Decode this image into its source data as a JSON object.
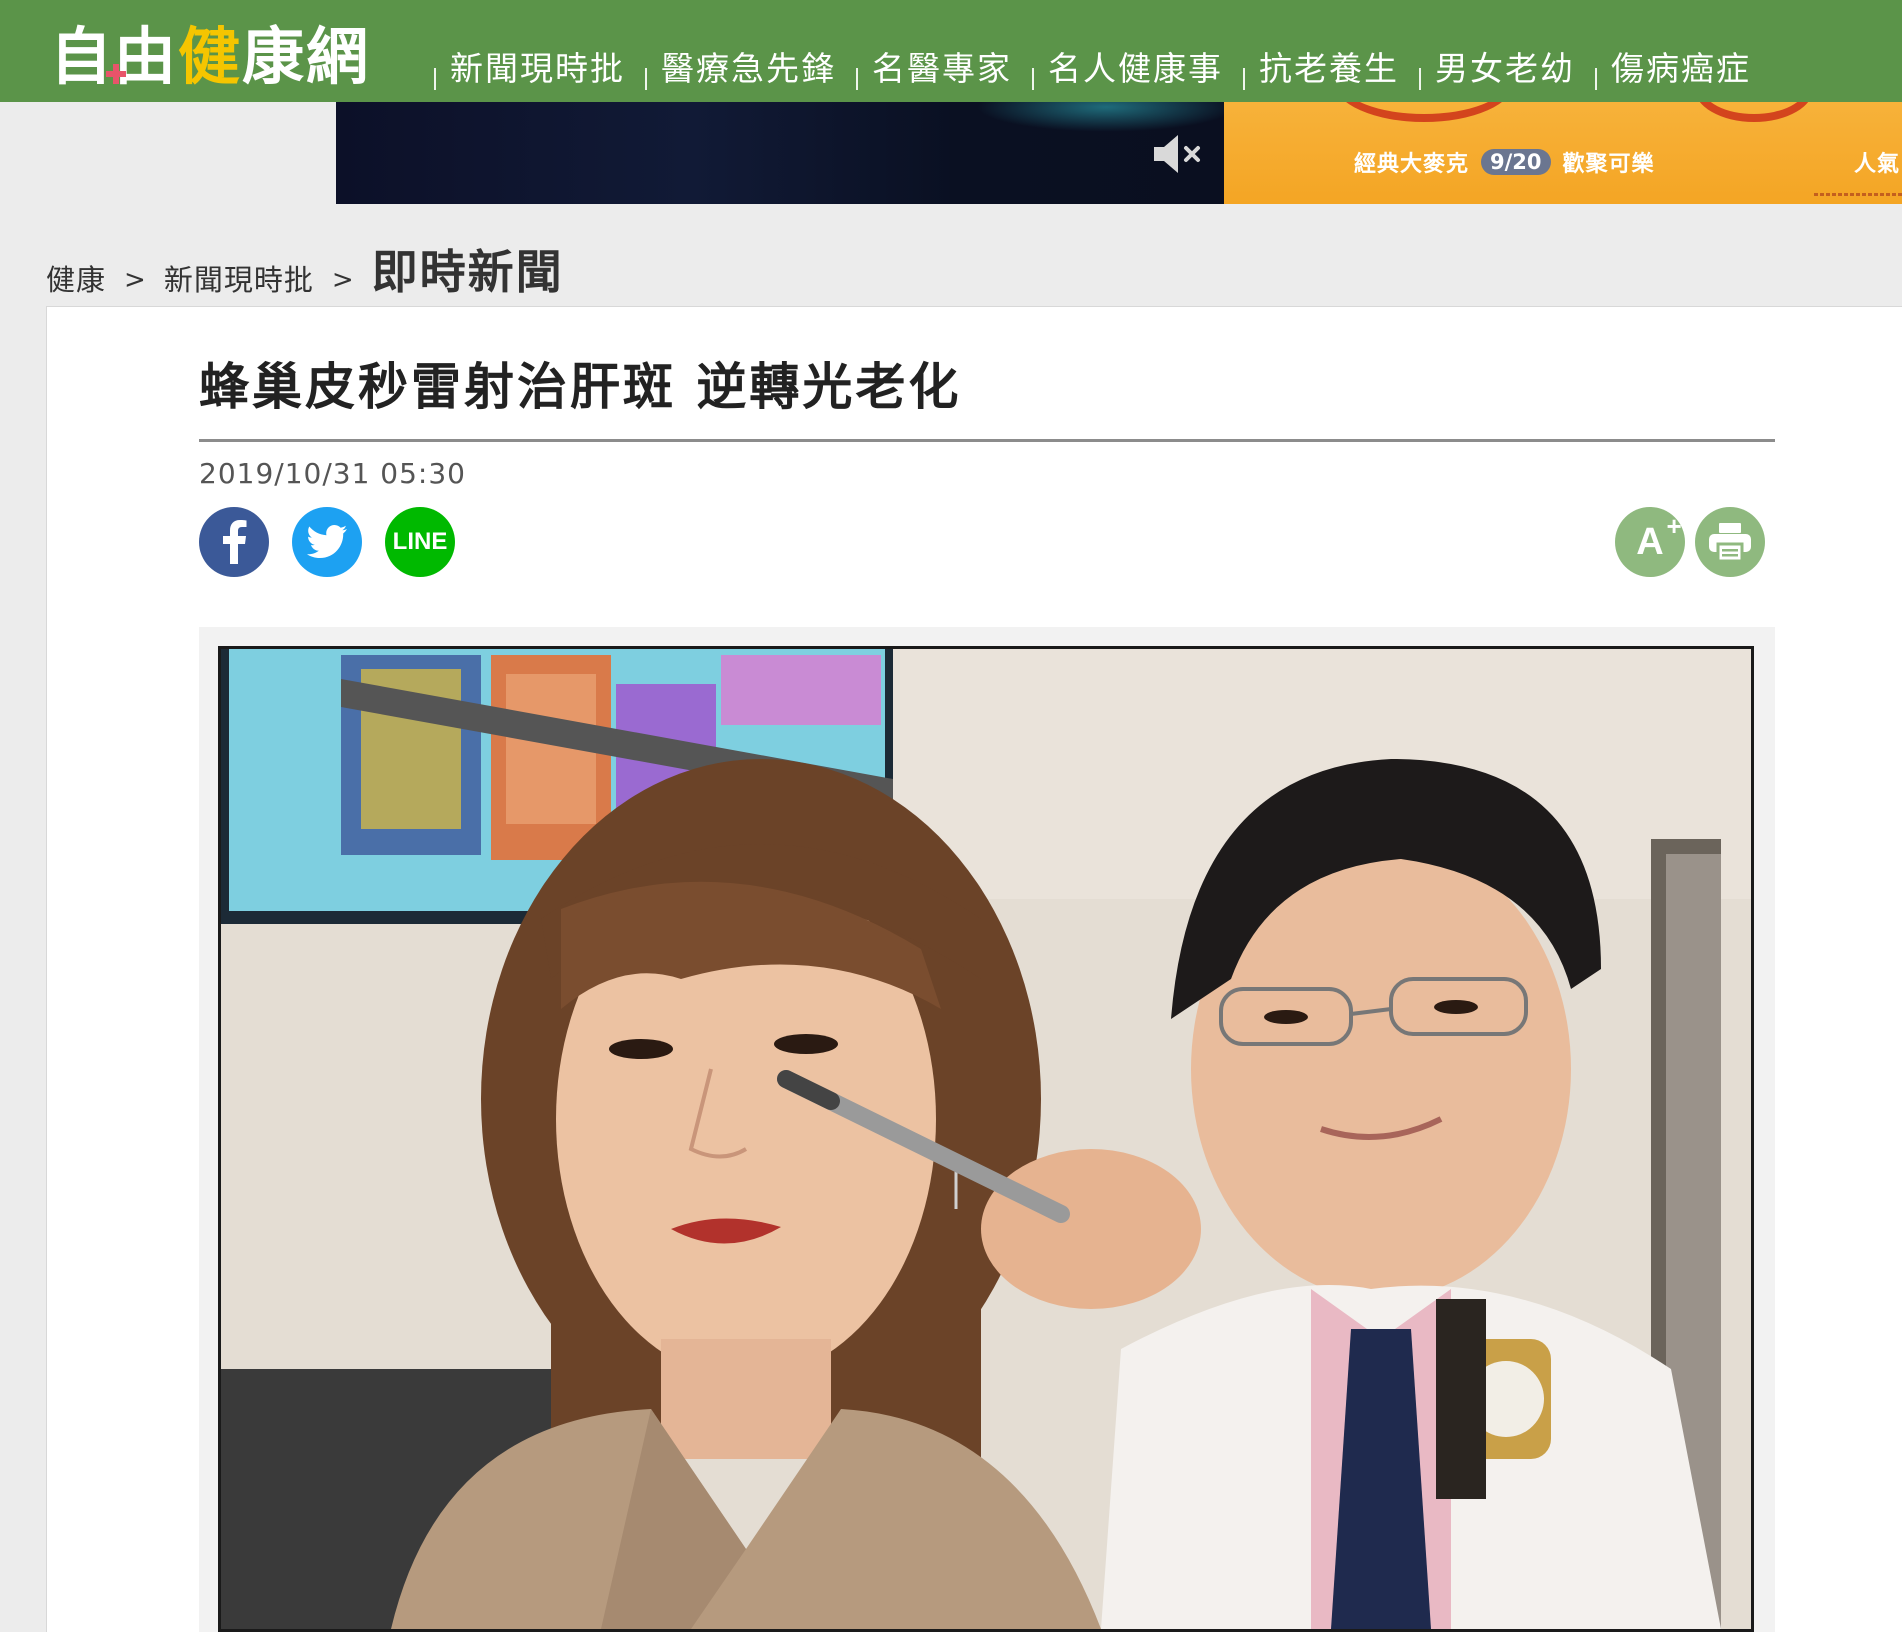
{
  "site": {
    "logo_part1": "自由",
    "logo_part2": "健",
    "logo_part3": "康網"
  },
  "nav": {
    "items": [
      {
        "label": "新聞現時批"
      },
      {
        "label": "醫療急先鋒"
      },
      {
        "label": "名醫專家"
      },
      {
        "label": "名人健康事"
      },
      {
        "label": "抗老養生"
      },
      {
        "label": "男女老幼"
      },
      {
        "label": "傷病癌症"
      }
    ]
  },
  "ad": {
    "promo_text_left": "經典大麥克",
    "promo_date": "9/20",
    "promo_text_mid": "歡聚可樂",
    "promo_text_right": "人氣"
  },
  "breadcrumb": {
    "items": [
      "健康",
      "新聞現時批"
    ],
    "separator": ">",
    "current": "即時新聞"
  },
  "article": {
    "title": "蜂巢皮秒雷射治肝斑 逆轉光老化",
    "date": "2019/10/31 05:30",
    "share": {
      "facebook_label": "f",
      "line_label": "LINE"
    },
    "tools": {
      "font_size_label": "A",
      "font_size_plus": "+"
    }
  },
  "colors": {
    "header_green": "#5b9449",
    "logo_accent": "#f5c500",
    "facebook": "#3b5998",
    "twitter": "#1da1f2",
    "line": "#00b900",
    "tool_green": "#8fb97f"
  },
  "icons": {
    "mute": "speaker-mute-icon",
    "facebook": "facebook-icon",
    "twitter": "twitter-bird-icon",
    "line": "line-icon",
    "font_size": "font-size-increase-icon",
    "print": "printer-icon"
  }
}
